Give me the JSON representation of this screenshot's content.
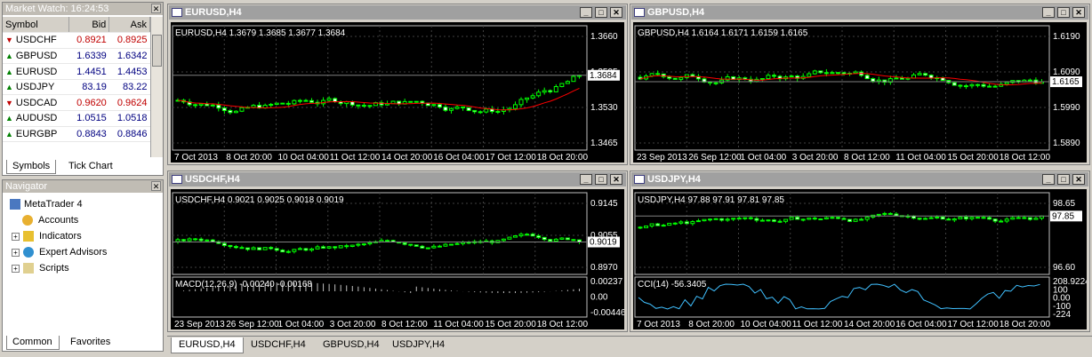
{
  "market_watch": {
    "title": "Market Watch: 16:24:53",
    "col_symbol": "Symbol",
    "col_bid": "Bid",
    "col_ask": "Ask",
    "rows": [
      {
        "symbol": "USDCHF",
        "bid": "0.8921",
        "ask": "0.8925",
        "dir": "down"
      },
      {
        "symbol": "GBPUSD",
        "bid": "1.6339",
        "ask": "1.6342",
        "dir": "up"
      },
      {
        "symbol": "EURUSD",
        "bid": "1.4451",
        "ask": "1.4453",
        "dir": "up"
      },
      {
        "symbol": "USDJPY",
        "bid": "83.19",
        "ask": "83.22",
        "dir": "up"
      },
      {
        "symbol": "USDCAD",
        "bid": "0.9620",
        "ask": "0.9624",
        "dir": "down"
      },
      {
        "symbol": "AUDUSD",
        "bid": "1.0515",
        "ask": "1.0518",
        "dir": "up"
      },
      {
        "symbol": "EURGBP",
        "bid": "0.8843",
        "ask": "0.8846",
        "dir": "up"
      }
    ],
    "tabs": [
      "Symbols",
      "Tick Chart"
    ]
  },
  "navigator": {
    "title": "Navigator",
    "root": "MetaTrader 4",
    "items": [
      "Accounts",
      "Indicators",
      "Expert Advisors",
      "Scripts"
    ],
    "tabs": [
      "Common",
      "Favorites"
    ]
  },
  "charts": {
    "eurusd": {
      "title": "EURUSD,H4",
      "info": "EURUSD,H4  1.3679 1.3685 1.3677 1.3684",
      "price_labels": [
        "1.3660",
        "1.3595",
        "1.3530",
        "1.3465"
      ],
      "current": "1.3684",
      "dates": [
        "7 Oct 2013",
        "8 Oct 20:00",
        "10 Oct 04:00",
        "11 Oct 12:00",
        "14 Oct 20:00",
        "16 Oct 04:00",
        "17 Oct 12:00",
        "18 Oct 20:00"
      ]
    },
    "gbpusd": {
      "title": "GBPUSD,H4",
      "info": "GBPUSD,H4  1.6164 1.6171 1.6159 1.6165",
      "price_labels": [
        "1.6190",
        "1.6090",
        "1.5990",
        "1.5890"
      ],
      "current": "1.6165",
      "dates": [
        "23 Sep 2013",
        "26 Sep 12:00",
        "1 Oct 04:00",
        "3 Oct 20:00",
        "8 Oct 12:00",
        "11 Oct 04:00",
        "15 Oct 20:00",
        "18 Oct 12:00"
      ]
    },
    "usdchf": {
      "title": "USDCHF,H4",
      "info": "USDCHF,H4  0.9021 0.9025 0.9018 0.9019",
      "price_labels": [
        "0.9145",
        "0.9055",
        "0.8970"
      ],
      "current": "0.9019",
      "macd_info": "MACD(12,26,9) -0.00240 -0.00168",
      "macd_labels": [
        "0.00237",
        "0.00",
        "-0.00446"
      ],
      "dates": [
        "23 Sep 2013",
        "26 Sep 12:00",
        "1 Oct 04:00",
        "3 Oct 20:00",
        "8 Oct 12:00",
        "11 Oct 04:00",
        "15 Oct 20:00",
        "18 Oct 12:00"
      ]
    },
    "usdjpy": {
      "title": "USDJPY,H4",
      "info": "USDJPY,H4  97.88 97.91 97.81 97.85",
      "price_labels": [
        "98.65",
        "96.60"
      ],
      "current": "97.85",
      "cci_info": "CCI(14) -56.3405",
      "cci_labels": [
        "208.9224",
        "100",
        "0.00",
        "-100",
        "-224"
      ],
      "dates": [
        "7 Oct 2013",
        "8 Oct 20:00",
        "10 Oct 04:00",
        "11 Oct 12:00",
        "14 Oct 20:00",
        "16 Oct 04:00",
        "17 Oct 12:00",
        "18 Oct 20:00"
      ]
    }
  },
  "bottom_tabs": [
    "EURUSD,H4",
    "USDCHF,H4",
    "GBPUSD,H4",
    "USDJPY,H4"
  ],
  "colors": {
    "bull": "#00ff00",
    "bear": "#ffffff",
    "ma": "#ff0000",
    "grid": "#404040",
    "bg": "#000000"
  }
}
